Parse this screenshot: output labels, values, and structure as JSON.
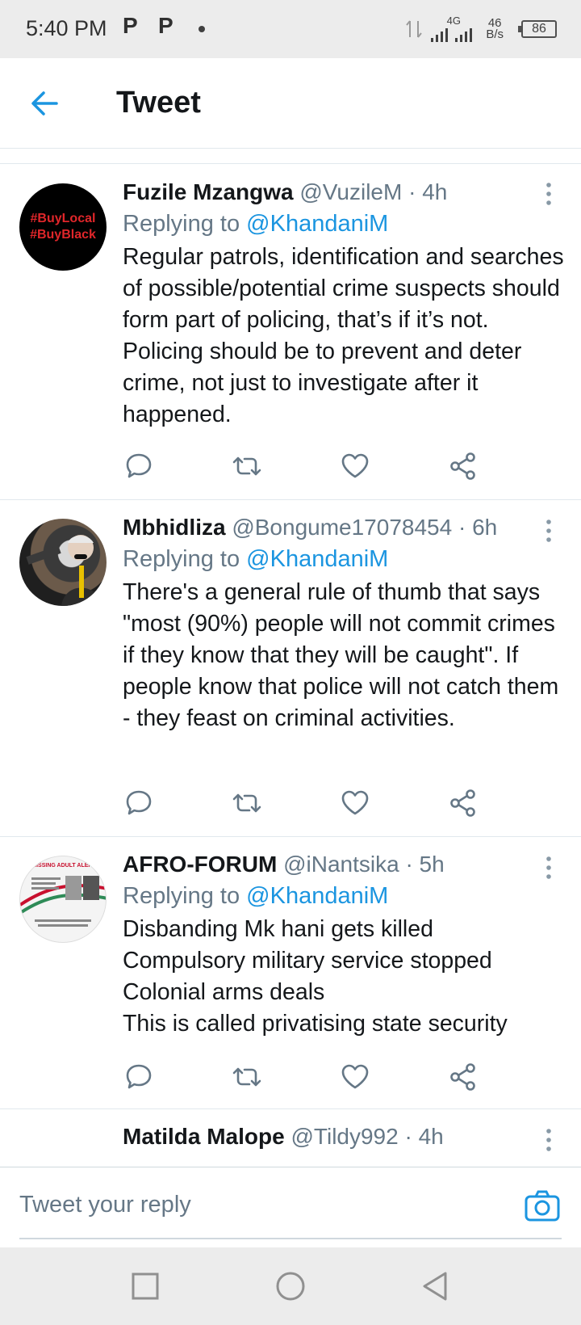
{
  "status_bar": {
    "time": "5:40 PM",
    "notif_icon_1": "P",
    "notif_icon_2": "P",
    "network": "4G",
    "speed_value": "46",
    "speed_unit": "B/s",
    "battery": "86"
  },
  "header": {
    "title": "Tweet",
    "back_icon": "arrow-left-icon"
  },
  "tweets": [
    {
      "name": "Fuzile Mzangwa",
      "handle": "@VuzileM",
      "time": "· 4h",
      "replying_prefix": "Replying to",
      "replying_to": "@KhandaniM",
      "text": "Regular patrols, identification and searches of possible/potential crime suspects should form part of policing, that’s if it’s not. Policing should be to prevent and deter crime, not just to investigate after it happened.",
      "avatar_text_1": "#BuyLocal",
      "avatar_text_2": "#BuyBlack"
    },
    {
      "name": "Mbhidliza",
      "handle": "@Bongume17078454",
      "time": "· 6h",
      "replying_prefix": "Replying to",
      "replying_to": "@KhandaniM",
      "text": "There's a general rule of thumb that says \"most (90%) people will not commit crimes if they know that they will be caught\". If people know that police will not catch them - they feast on criminal activities."
    },
    {
      "name": "AFRO-FORUM",
      "handle": "@iNantsika",
      "time": "· 5h",
      "replying_prefix": "Replying to",
      "replying_to": "@KhandaniM",
      "text_lines": [
        "Disbanding Mk hani gets killed",
        "Compulsory military service stopped",
        "Colonial arms deals",
        "This is called privatising state security"
      ],
      "avatar_text": "MISSING ADULT ALERT"
    },
    {
      "name": "Matilda Malope",
      "handle": "@Tildy992",
      "time": "· 4h"
    }
  ],
  "reply_bar": {
    "placeholder": "Tweet your reply",
    "camera_icon": "camera-icon"
  },
  "colors": {
    "accent": "#1b95e0",
    "text": "#14171a",
    "secondary": "#657786"
  }
}
